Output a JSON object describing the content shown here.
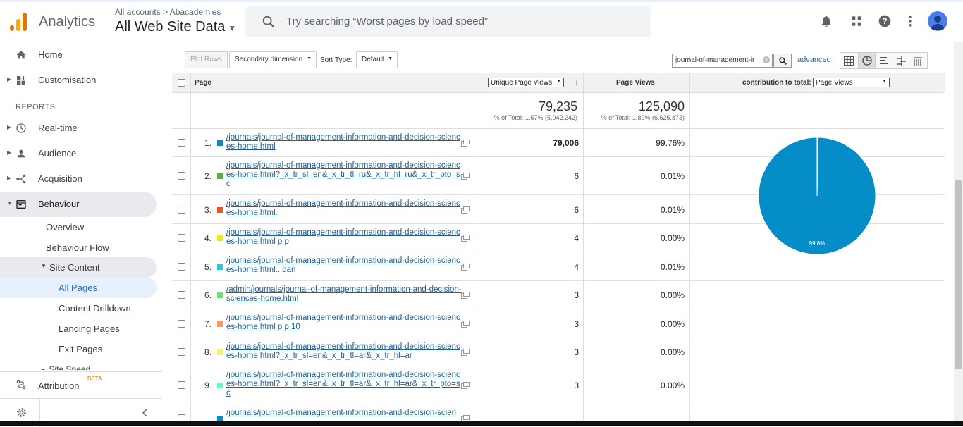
{
  "app": {
    "name": "Analytics"
  },
  "account": {
    "breadcrumb": "All accounts > Abacademies",
    "property": "All Web Site Data"
  },
  "search": {
    "placeholder": "Try searching “Worst pages by load speed”"
  },
  "icons": {
    "bell": "bell-icon",
    "apps": "apps-grid-icon",
    "help": "help-icon",
    "more": "more-vert-icon",
    "avatar": "account-avatar"
  },
  "sidebar": {
    "home": "Home",
    "customisation": "Customisation",
    "reports_header": "REPORTS",
    "realtime": "Real-time",
    "audience": "Audience",
    "acquisition": "Acquisition",
    "behaviour": "Behaviour",
    "overview": "Overview",
    "behaviour_flow": "Behaviour Flow",
    "site_content": "Site Content",
    "all_pages": "All Pages",
    "content_drilldown": "Content Drilldown",
    "landing_pages": "Landing Pages",
    "exit_pages": "Exit Pages",
    "site_speed": "Site Speed",
    "attribution": "Attribution",
    "beta": "BETA"
  },
  "toolbar": {
    "plot_rows": "Plot Rows",
    "secondary_dimension": "Secondary dimension",
    "sort_type_label": "Sort Type:",
    "sort_type_value": "Default",
    "filter_value": "journal-of-management-ir",
    "advanced": "advanced"
  },
  "table": {
    "col_page": "Page",
    "col_unique": "Unique Page Views",
    "col_pageviews": "Page Views",
    "col_contribution": "contribution to total:",
    "contribution_select": "Page Views",
    "total_unique": "79,235",
    "total_unique_pct": "% of Total: 1.57% (5,042,242)",
    "total_pageviews": "125,090",
    "total_pageviews_pct": "% of Total: 1.89% (6,625,873)",
    "rows": [
      {
        "n": "1.",
        "page": "/journals/journal-of-management-information-and-decision-sciences-home.html",
        "unique": "79,006",
        "pct": "99.76%",
        "color": "#058dc7"
      },
      {
        "n": "2.",
        "page": "/journals/journal-of-management-information-and-decision-sciences-home.html?_x_tr_sl=en&_x_tr_tl=ru&_x_tr_hl=ru&_x_tr_pto=sc",
        "unique": "6",
        "pct": "0.01%",
        "color": "#50b432"
      },
      {
        "n": "3.",
        "page": "/journals/journal-of-management-information-and-decision-sciences-home.html.",
        "unique": "6",
        "pct": "0.01%",
        "color": "#ed561b"
      },
      {
        "n": "4.",
        "page": "/journals/journal-of-management-information-and-decision-sciences-home.html p p",
        "unique": "4",
        "pct": "0.00%",
        "color": "#edef00"
      },
      {
        "n": "5.",
        "page": "/journals/journal-of-management-information-and-decision-sciences-home.html...dan",
        "unique": "4",
        "pct": "0.01%",
        "color": "#24cbe5"
      },
      {
        "n": "6.",
        "page": "/admin/journals/journal-of-management-information-and-decision-sciences-home.html",
        "unique": "3",
        "pct": "0.00%",
        "color": "#64e572"
      },
      {
        "n": "7.",
        "page": "/journals/journal-of-management-information-and-decision-sciences-home.html p p 10",
        "unique": "3",
        "pct": "0.00%",
        "color": "#ff9655"
      },
      {
        "n": "8.",
        "page": "/journals/journal-of-management-information-and-decision-sciences-home.html?_x_tr_sl=en&_x_tr_tl=ar&_x_tr_hl=ar",
        "unique": "3",
        "pct": "0.00%",
        "color": "#fff263"
      },
      {
        "n": "9.",
        "page": "/journals/journal-of-management-information-and-decision-sciences-home.html?_x_tr_sl=en&_x_tr_tl=ar&_x_tr_hl=ar&_x_tr_pto=sc",
        "unique": "3",
        "pct": "0.00%",
        "color": "#6af9c4"
      },
      {
        "n": "",
        "page": "/journals/journal-of-management-information-and-decision-scien",
        "unique": "",
        "pct": "",
        "color": "#058dc7"
      }
    ]
  },
  "chart_data": {
    "type": "pie",
    "slices": [
      {
        "label": "99.8%",
        "value": 99.76,
        "color": "#058dc7"
      },
      {
        "label": "",
        "value": 0.24,
        "color": "#ffffff"
      }
    ]
  }
}
